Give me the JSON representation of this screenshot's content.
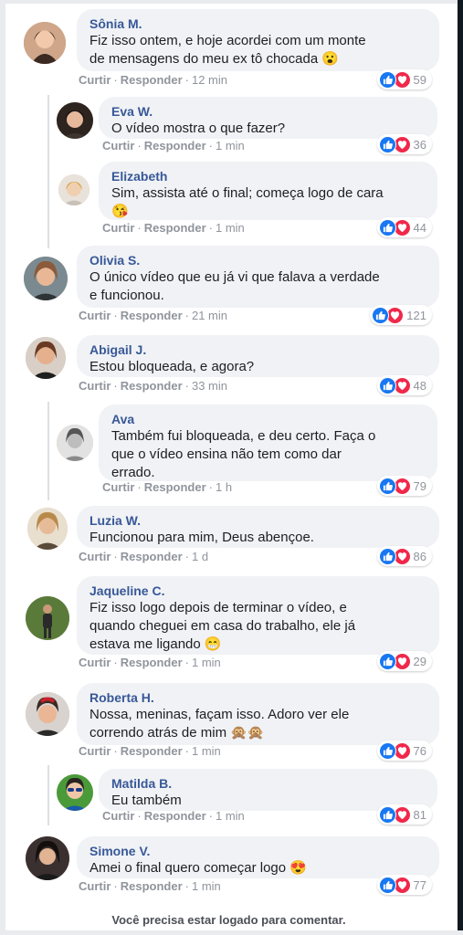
{
  "ui": {
    "like_label": "Curtir",
    "reply_label": "Responder",
    "dot": "·",
    "footer_text": "Você precisa estar logado para comentar."
  },
  "comments": [
    {
      "author": "Sônia M.",
      "line1": "Fiz isso ontem, e hoje acordei com um monte",
      "line2": "de mensagens do meu ex tô chocada 😮",
      "line3": "",
      "time": "12 min",
      "reactions": "59"
    },
    {
      "author": "Eva W.",
      "line1": "O vídeo mostra o que fazer?",
      "line2": "",
      "line3": "",
      "time": "1 min",
      "reactions": "36"
    },
    {
      "author": "Elizabeth",
      "line1": "Sim, assista até o final; começa logo de cara",
      "line2": "😘",
      "line3": "",
      "time": "1 min",
      "reactions": "44"
    },
    {
      "author": "Olivia S.",
      "line1": "O único vídeo que eu já vi que falava a verdade",
      "line2": "e funcionou.",
      "line3": "",
      "time": "21 min",
      "reactions": "121"
    },
    {
      "author": "Abigail J.",
      "line1": "Estou bloqueada, e agora?",
      "line2": "",
      "line3": "",
      "time": "33 min",
      "reactions": "48"
    },
    {
      "author": "Ava",
      "line1": "Também fui bloqueada, e deu certo. Faça o",
      "line2": "que o vídeo ensina não tem como dar",
      "line3": "errado.",
      "time": "1 h",
      "reactions": "79"
    },
    {
      "author": "Luzia W.",
      "line1": "Funcionou para mim, Deus abençoe.",
      "line2": "",
      "line3": "",
      "time": "1 d",
      "reactions": "86"
    },
    {
      "author": "Jaqueline C.",
      "line1": "Fiz isso logo depois de terminar o vídeo, e",
      "line2": "quando cheguei em casa do trabalho, ele já",
      "line3": "estava me ligando 😁",
      "time": "1 min",
      "reactions": "29"
    },
    {
      "author": "Roberta H.",
      "line1": "Nossa, meninas, façam isso. Adoro ver ele",
      "line2": "correndo atrás de mim 🙊🙊",
      "line3": "",
      "time": "1 min",
      "reactions": "76"
    },
    {
      "author": "Matilda B.",
      "line1": "Eu também",
      "line2": "",
      "line3": "",
      "time": "1 min",
      "reactions": "81"
    },
    {
      "author": "Simone V.",
      "line1": "Amei o final quero começar logo 😍",
      "line2": "",
      "line3": "",
      "time": "1 min",
      "reactions": "77"
    }
  ],
  "colors": {
    "author": "#385898",
    "bubble": "#f0f2f5",
    "like": "#1877f2",
    "love": "#f0284a",
    "meta": "#90949c"
  },
  "icons": {
    "like": "thumbs-up-icon",
    "love": "heart-icon",
    "avatar": "profile-photo"
  }
}
